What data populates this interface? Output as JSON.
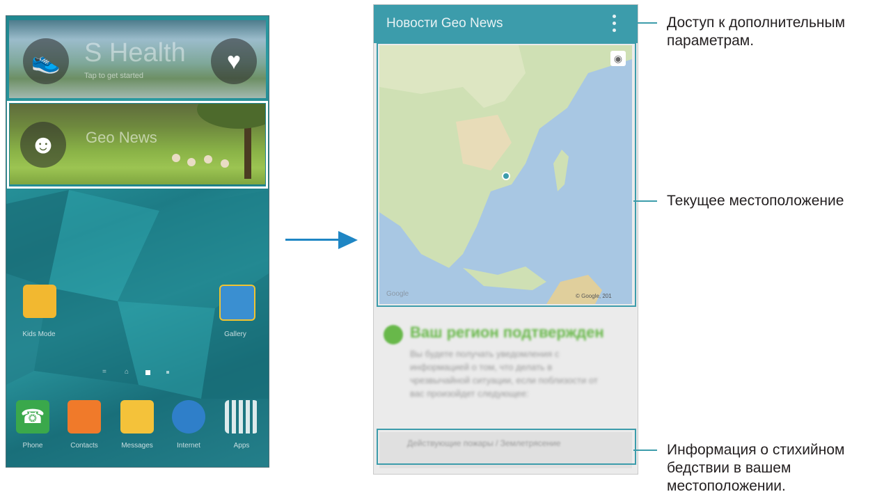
{
  "home_screen": {
    "shealth_widget": {
      "title": "S Health",
      "subtitle": "Tap to get started"
    },
    "geonews_widget": {
      "title": "Geo News",
      "subtitle": "Geo News"
    },
    "apps": [
      {
        "label": "Kids Mode",
        "icon": "kids-mode-icon"
      },
      {
        "label": "Gallery",
        "icon": "gallery-icon"
      }
    ],
    "dock": [
      {
        "label": "Phone",
        "icon": "phone-icon"
      },
      {
        "label": "Contacts",
        "icon": "contacts-icon"
      },
      {
        "label": "Messages",
        "icon": "messages-icon"
      },
      {
        "label": "Internet",
        "icon": "internet-icon"
      },
      {
        "label": "Apps",
        "icon": "apps-grid-icon"
      }
    ]
  },
  "geo_news": {
    "title": "Новости Geo News",
    "map_attribution": "© Google, 201",
    "map_watermark": "Google",
    "confirm_title": "Ваш регион подтвержден",
    "confirm_text": "Вы будете получать уведомления с информацией о том, что делать в чрезвычайной ситуации, если поблизости от вас произойдет следующее:",
    "disaster_item": "Действующие пожары / Землетрясение"
  },
  "callouts": {
    "more_options": "Доступ к дополнительным параметрам.",
    "current_location": "Текущее местоположение",
    "disaster_info": "Информация о стихийном бедствии в вашем местоположении."
  },
  "colors": {
    "accent": "#3c9cab",
    "arrow": "#1f86c4",
    "confirm_green": "#68b84a"
  }
}
